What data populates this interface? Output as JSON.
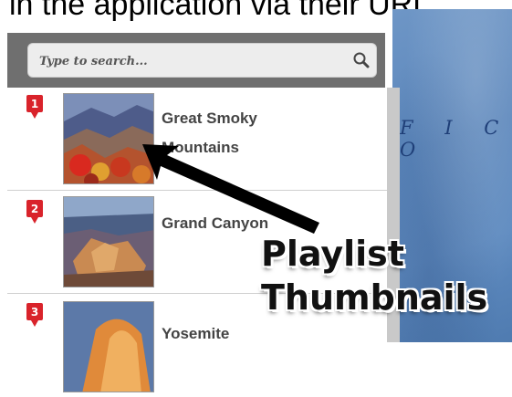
{
  "caption": "in the application via their URL.",
  "search": {
    "placeholder": "Type to search..."
  },
  "map": {
    "ocean_label": "F I C  O"
  },
  "playlist": [
    {
      "number": "1",
      "title_line1": "Great Smoky",
      "title_line2": "Mountains"
    },
    {
      "number": "2",
      "title_line1": "Grand Canyon",
      "title_line2": ""
    },
    {
      "number": "3",
      "title_line1": "Yosemite",
      "title_line2": ""
    }
  ],
  "annotation": {
    "line1": "Playlist",
    "line2": "Thumbnails"
  },
  "colors": {
    "marker": "#d9232b",
    "map_water": "#5f8bc0",
    "search_bar": "#6f6f6f"
  }
}
